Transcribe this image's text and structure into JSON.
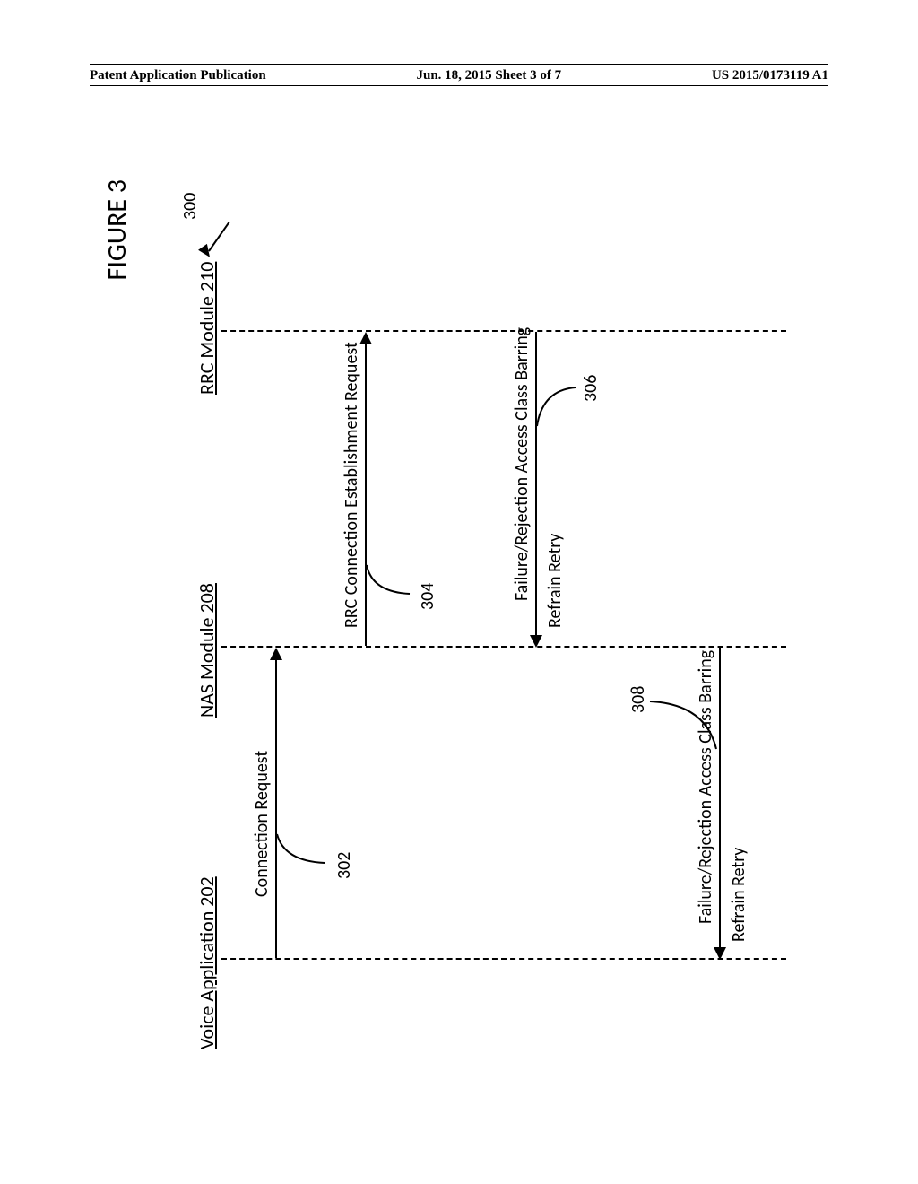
{
  "header": {
    "left": "Patent Application Publication",
    "center": "Jun. 18, 2015  Sheet 3 of 7",
    "right": "US 2015/0173119 A1"
  },
  "figure": {
    "title": "FIGURE 3",
    "ref_main": "300",
    "lifelines": {
      "voice": "Voice Application 202",
      "nas": "NAS Module 208",
      "rrc": "RRC Module 210"
    },
    "messages": {
      "m302": {
        "label": "Connection Request",
        "ref": "302"
      },
      "m304": {
        "label": "RRC Connection Establishment Request",
        "ref": "304"
      },
      "m306": {
        "label": "Failure/Rejection Access Class Barring",
        "ref": "306"
      },
      "m308": {
        "label": "Failure/Rejection Access Class Barring",
        "ref": "308"
      }
    },
    "refrain": "Refrain Retry"
  }
}
